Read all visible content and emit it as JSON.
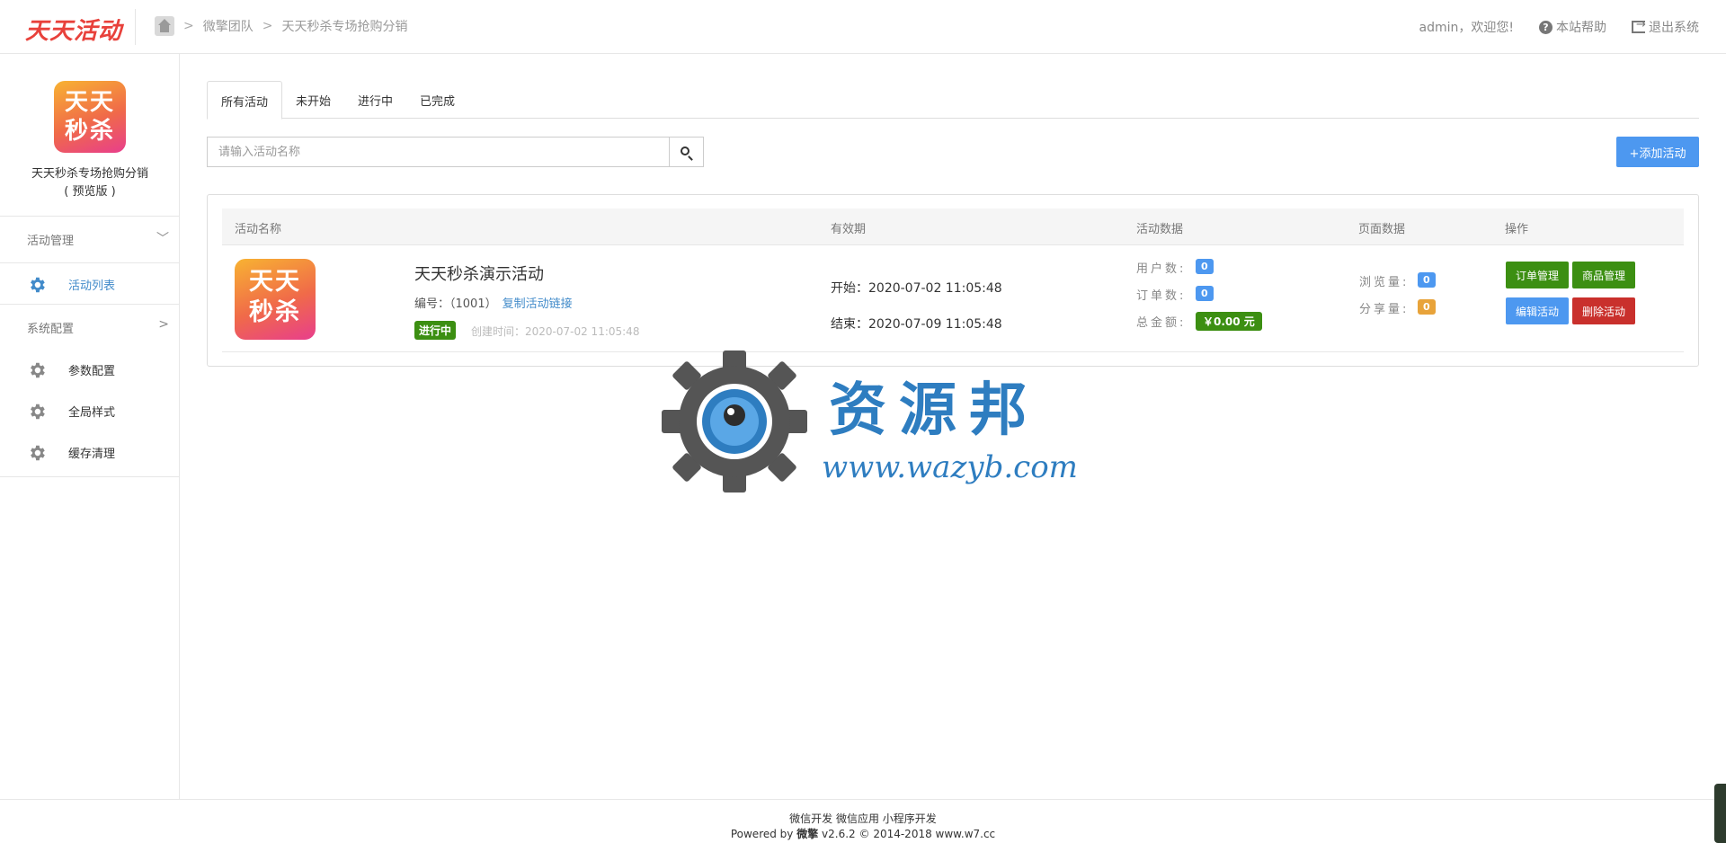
{
  "header": {
    "logo_text": "天天活动",
    "breadcrumb": [
      "微擎团队",
      "天天秒杀专场抢购分销"
    ],
    "greeting": "admin，欢迎您!",
    "help": "本站帮助",
    "logout": "退出系统"
  },
  "sidebar": {
    "app_logo_line1": "天天",
    "app_logo_line2": "秒杀",
    "app_name_line1": "天天秒杀专场抢购分销",
    "app_name_line2": "( 预览版 )",
    "groups": [
      {
        "label": "活动管理",
        "items": [
          {
            "label": "活动列表",
            "active": true
          }
        ]
      },
      {
        "label": "系统配置",
        "items": [
          {
            "label": "参数配置"
          },
          {
            "label": "全局样式"
          },
          {
            "label": "缓存清理"
          }
        ]
      }
    ]
  },
  "tabs": [
    "所有活动",
    "未开始",
    "进行中",
    "已完成"
  ],
  "search": {
    "placeholder": "请输入活动名称"
  },
  "add_button": "+添加活动",
  "table": {
    "headers": [
      "活动名称",
      "有效期",
      "活动数据",
      "页面数据",
      "操作"
    ],
    "rows": [
      {
        "logo_line1": "天天",
        "logo_line2": "秒杀",
        "title": "天天秒杀演示活动",
        "id_label": "编号：（1001）",
        "copy_link": "复制活动链接",
        "status": "进行中",
        "created": "创建时间：2020-07-02 11:05:48",
        "start": "开始：2020-07-02 11:05:48",
        "end": "结束：2020-07-09 11:05:48",
        "users_label": "用户数:",
        "users": "0",
        "orders_label": "订单数:",
        "orders": "0",
        "amount_label": "总金额:",
        "amount": "￥0.00 元",
        "views_label": "浏览量:",
        "views": "0",
        "shares_label": "分享量:",
        "shares": "0",
        "actions": [
          "订单管理",
          "商品管理",
          "编辑活动",
          "删除活动"
        ]
      }
    ]
  },
  "watermark": {
    "text": "资源邦",
    "url": "www.wazyb.com"
  },
  "footer": {
    "links": "微信开发 微信应用 小程序开发",
    "powered_prefix": "Powered by ",
    "powered_brand": "微擎",
    "powered_suffix": " v2.6.2 © 2014-2018 www.w7.cc"
  },
  "colors": {
    "primary": "#4d98f0",
    "success": "#3c8f12",
    "danger": "#c9302c",
    "warning": "#e8a33a",
    "link": "#428bca"
  }
}
